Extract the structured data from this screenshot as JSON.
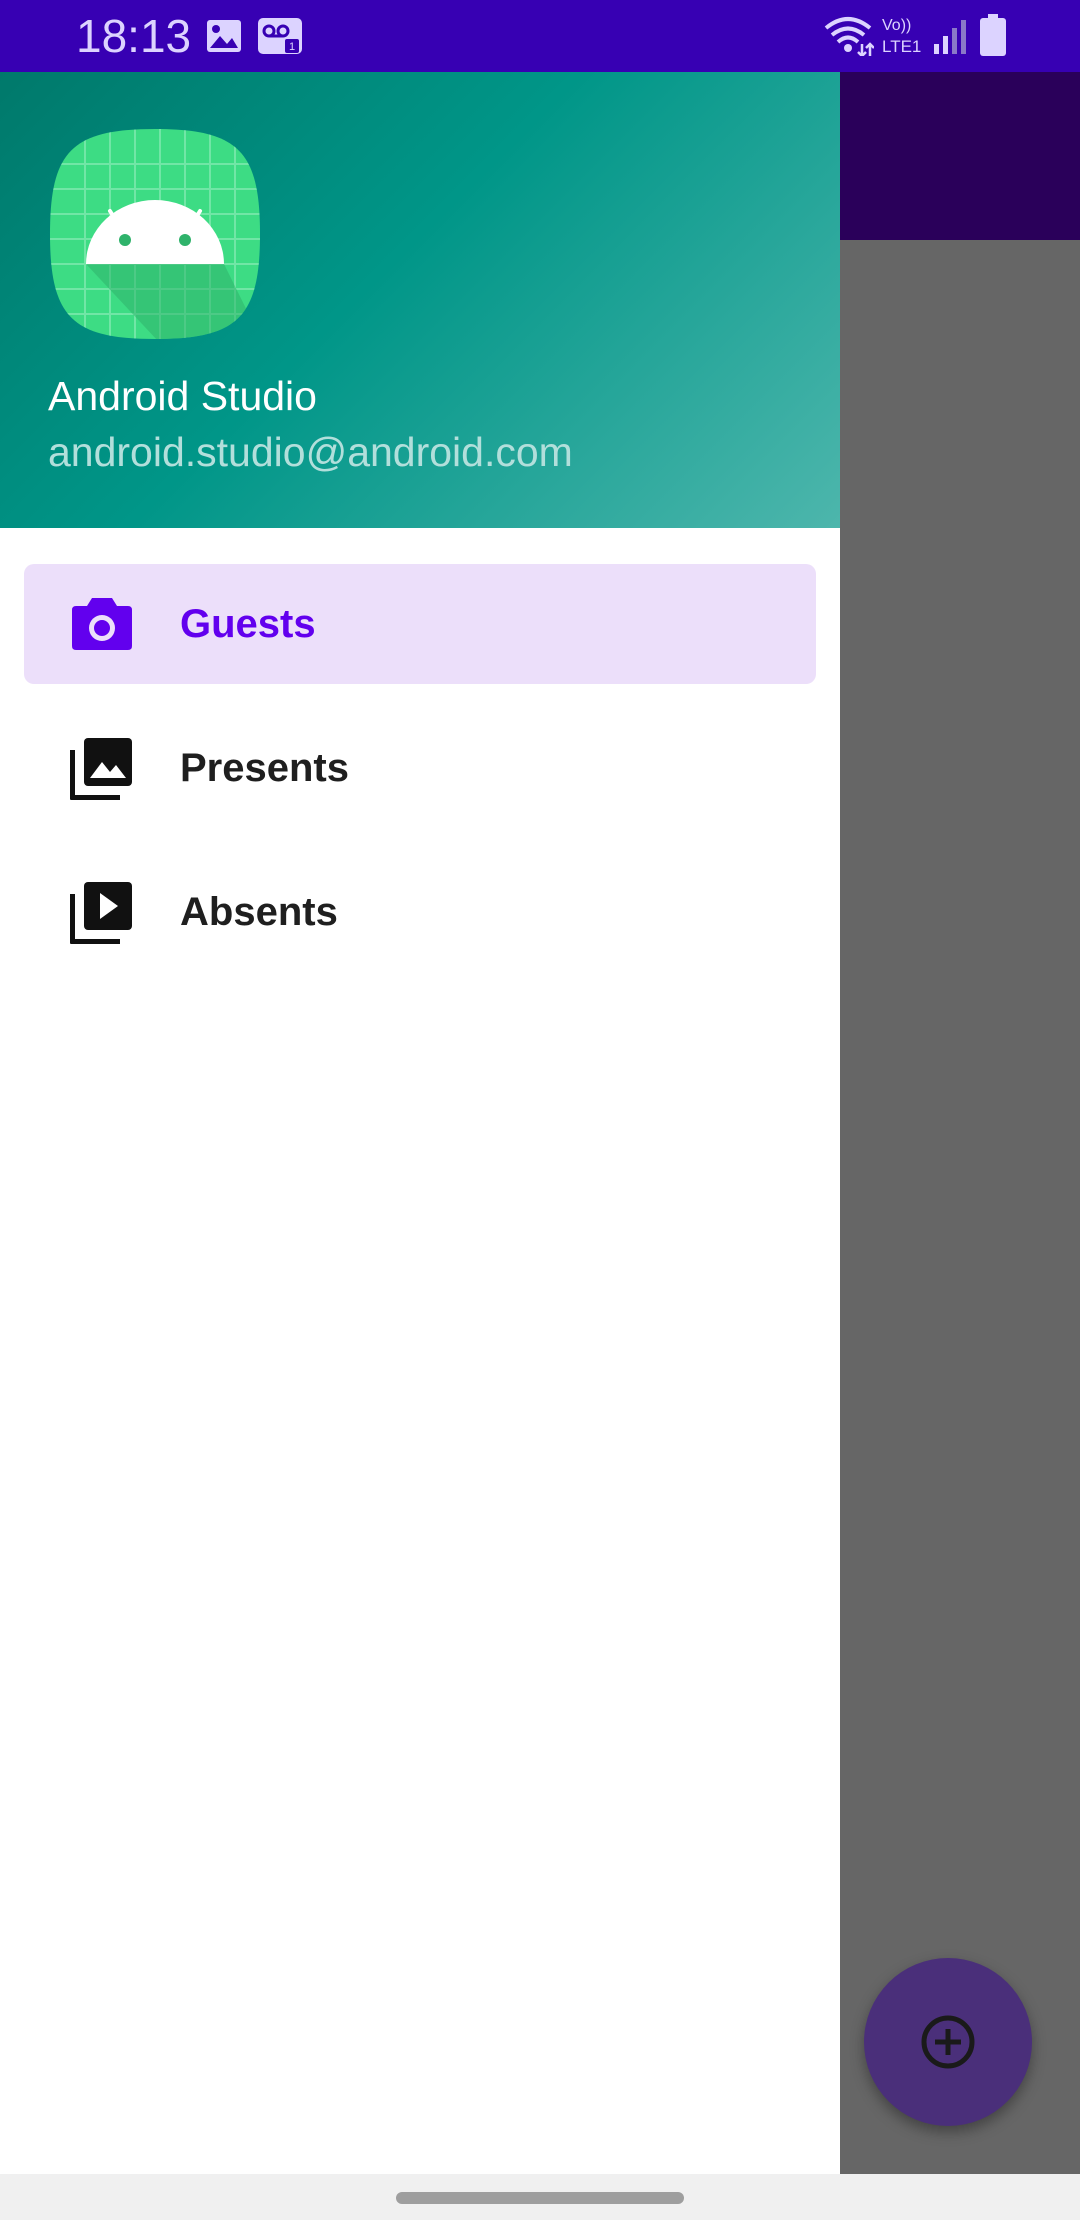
{
  "status_bar": {
    "time": "18:13",
    "left_icons": [
      "image-icon",
      "voicemail-icon"
    ],
    "right_icons": [
      "wifi-icon",
      "volte-icon",
      "signal-icon",
      "battery-icon"
    ],
    "volte_top": "Vo))",
    "volte_bottom": "LTE1"
  },
  "drawer": {
    "header": {
      "name": "Android Studio",
      "email": "android.studio@android.com",
      "avatar_icon": "android-logo-icon"
    },
    "menu": [
      {
        "label": "Guests",
        "icon": "camera-icon",
        "selected": true
      },
      {
        "label": "Presents",
        "icon": "photo-library-icon",
        "selected": false
      },
      {
        "label": "Absents",
        "icon": "video-library-icon",
        "selected": false
      }
    ]
  },
  "fab": {
    "icon": "add-circle-icon"
  },
  "colors": {
    "status_bar": "#3700b3",
    "accent": "#6200ee",
    "selected_bg": "#ecdffa",
    "header_teal": "#009688"
  }
}
